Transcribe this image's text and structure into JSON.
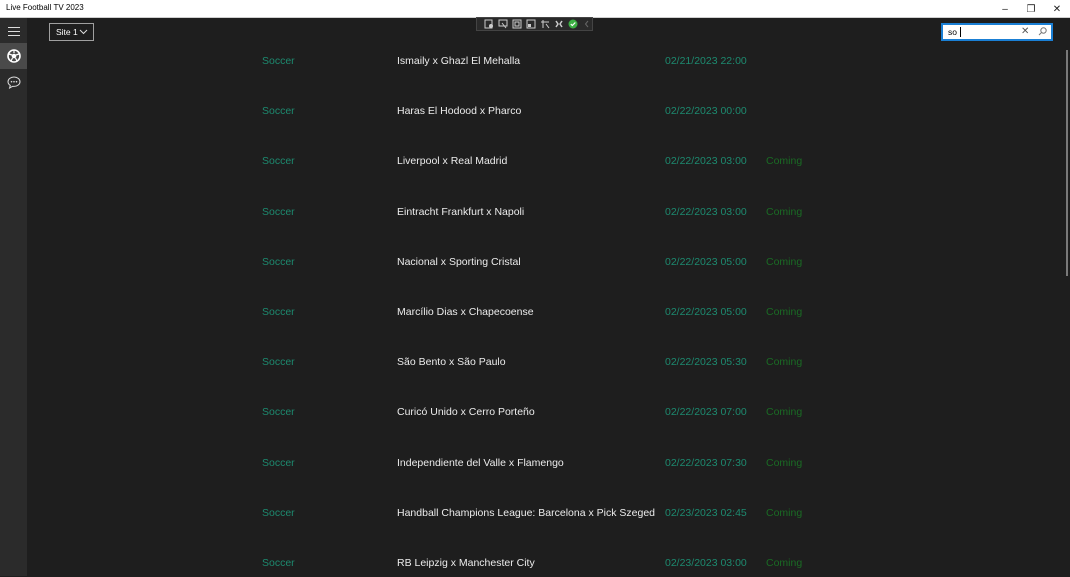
{
  "window": {
    "title": "Live Football TV 2023",
    "controls": {
      "minimize": "–",
      "maximize": "❐",
      "close": "✕"
    }
  },
  "sidebar": {
    "items": [
      {
        "name": "menu",
        "icon": "hamburger-icon",
        "active": false
      },
      {
        "name": "soccer",
        "icon": "soccer-ball-icon",
        "active": true
      },
      {
        "name": "chat",
        "icon": "chat-bubble-icon",
        "active": false
      }
    ]
  },
  "toolbar": {
    "site_select": {
      "value": "Site 1"
    },
    "search": {
      "value": "so",
      "placeholder": ""
    }
  },
  "devbar": {
    "icons": [
      "visual-tree-icon",
      "select-element-icon",
      "display-layout-adorners-icon",
      "track-focus-icon",
      "binding-failures-icon",
      "hot-reload-icon",
      "status-ok-icon",
      "collapse-icon"
    ]
  },
  "events": [
    {
      "category": "Soccer",
      "match": "Ismaily x Ghazl El Mehalla",
      "datetime": "02/21/2023 22:00",
      "status": ""
    },
    {
      "category": "Soccer",
      "match": "Haras El Hodood x Pharco",
      "datetime": "02/22/2023 00:00",
      "status": ""
    },
    {
      "category": "Soccer",
      "match": "Liverpool x Real Madrid",
      "datetime": "02/22/2023 03:00",
      "status": "Coming"
    },
    {
      "category": "Soccer",
      "match": "Eintracht Frankfurt x Napoli",
      "datetime": "02/22/2023 03:00",
      "status": "Coming"
    },
    {
      "category": "Soccer",
      "match": "Nacional x Sporting Cristal",
      "datetime": "02/22/2023 05:00",
      "status": "Coming"
    },
    {
      "category": "Soccer",
      "match": "Marcílio Dias x Chapecoense",
      "datetime": "02/22/2023 05:00",
      "status": "Coming"
    },
    {
      "category": "Soccer",
      "match": "São Bento x São Paulo",
      "datetime": "02/22/2023 05:30",
      "status": "Coming"
    },
    {
      "category": "Soccer",
      "match": "Curicó Unido x Cerro Porteño",
      "datetime": "02/22/2023 07:00",
      "status": "Coming"
    },
    {
      "category": "Soccer",
      "match": "Independiente del Valle x Flamengo",
      "datetime": "02/22/2023 07:30",
      "status": "Coming"
    },
    {
      "category": "Soccer",
      "match": "Handball Champions League: Barcelona x Pick Szeged",
      "datetime": "02/23/2023 02:45",
      "status": "Coming"
    },
    {
      "category": "Soccer",
      "match": "RB Leipzig x Manchester City",
      "datetime": "02/23/2023 03:00",
      "status": "Coming"
    }
  ],
  "colors": {
    "accent": "#1a7fd4",
    "category_text": "#1d8a6f",
    "datetime_text": "#1d8a6f",
    "status_text": "#1a6b24",
    "background": "#1e1e1e",
    "sidebar": "#2b2b2b"
  }
}
